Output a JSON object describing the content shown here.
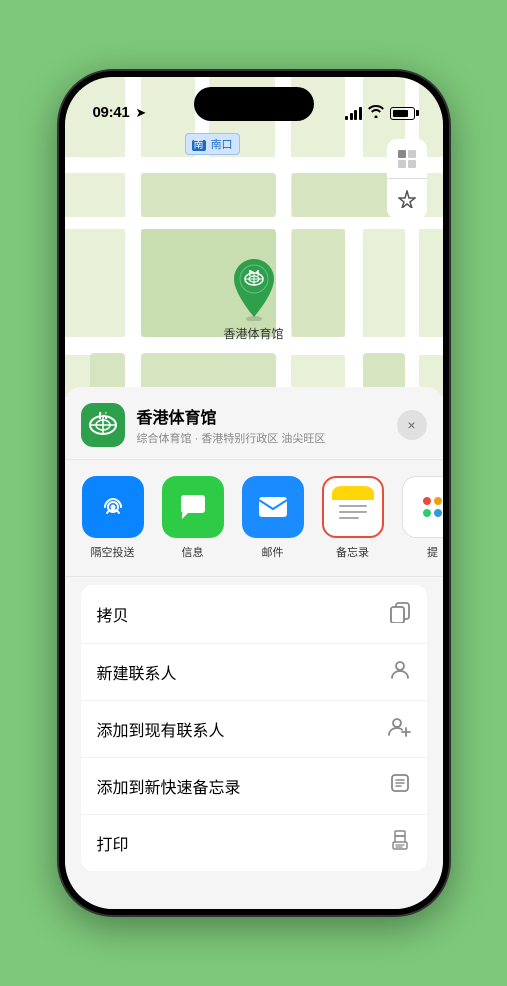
{
  "status_bar": {
    "time": "09:41",
    "location_arrow": "▶"
  },
  "map": {
    "venue_label": "南口",
    "venue_label_prefix": "南",
    "pin_venue_name": "香港体育馆"
  },
  "bottom_sheet": {
    "venue_title": "香港体育馆",
    "venue_subtitle": "综合体育馆 · 香港特别行政区 油尖旺区",
    "close_label": "×",
    "share_items": [
      {
        "id": "airdrop",
        "label": "隔空投送"
      },
      {
        "id": "messages",
        "label": "信息"
      },
      {
        "id": "mail",
        "label": "邮件"
      },
      {
        "id": "notes",
        "label": "备忘录"
      },
      {
        "id": "more",
        "label": "提"
      }
    ],
    "action_items": [
      {
        "label": "拷贝",
        "icon": "copy"
      },
      {
        "label": "新建联系人",
        "icon": "person"
      },
      {
        "label": "添加到现有联系人",
        "icon": "person-add"
      },
      {
        "label": "添加到新快速备忘录",
        "icon": "note"
      },
      {
        "label": "打印",
        "icon": "print"
      }
    ]
  }
}
